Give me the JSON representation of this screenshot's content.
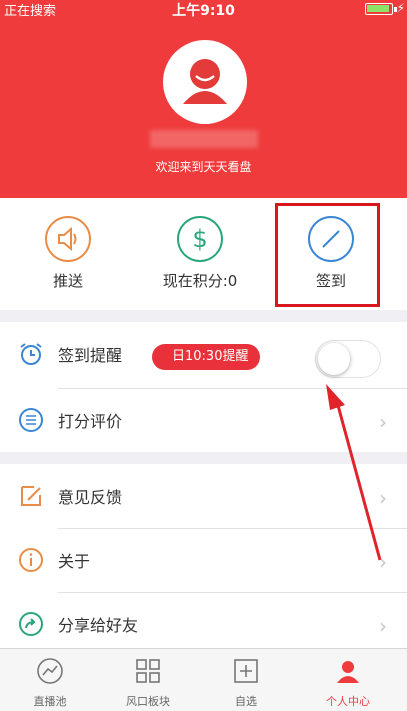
{
  "status_bar": {
    "left_text": "正在搜索",
    "time": "上午9:10"
  },
  "header": {
    "welcome": "欢迎来到天天看盘",
    "bg_color": "#ef3b3b"
  },
  "quick_actions": [
    {
      "label": "推送",
      "icon": "speaker-icon",
      "color": "#e88c47"
    },
    {
      "label": "现在积分:0",
      "icon": "dollar-icon",
      "color": "#2aa67b"
    },
    {
      "label": "签到",
      "icon": "pen-icon",
      "color": "#3a86d6"
    }
  ],
  "settings": {
    "reminder": {
      "label": "签到提醒",
      "pill": "日10:30提醒",
      "toggle_on": false
    },
    "rate_label": "打分评价",
    "feedback_label": "意见反馈",
    "about_label": "关于",
    "share_label": "分享给好友"
  },
  "tabs": [
    {
      "label": "直播池",
      "icon": "chart-icon"
    },
    {
      "label": "风口板块",
      "icon": "grid-icon"
    },
    {
      "label": "自选",
      "icon": "add-square-icon"
    },
    {
      "label": "个人中心",
      "icon": "person-icon",
      "active": true
    }
  ],
  "accent_color": "#ef3b3b"
}
